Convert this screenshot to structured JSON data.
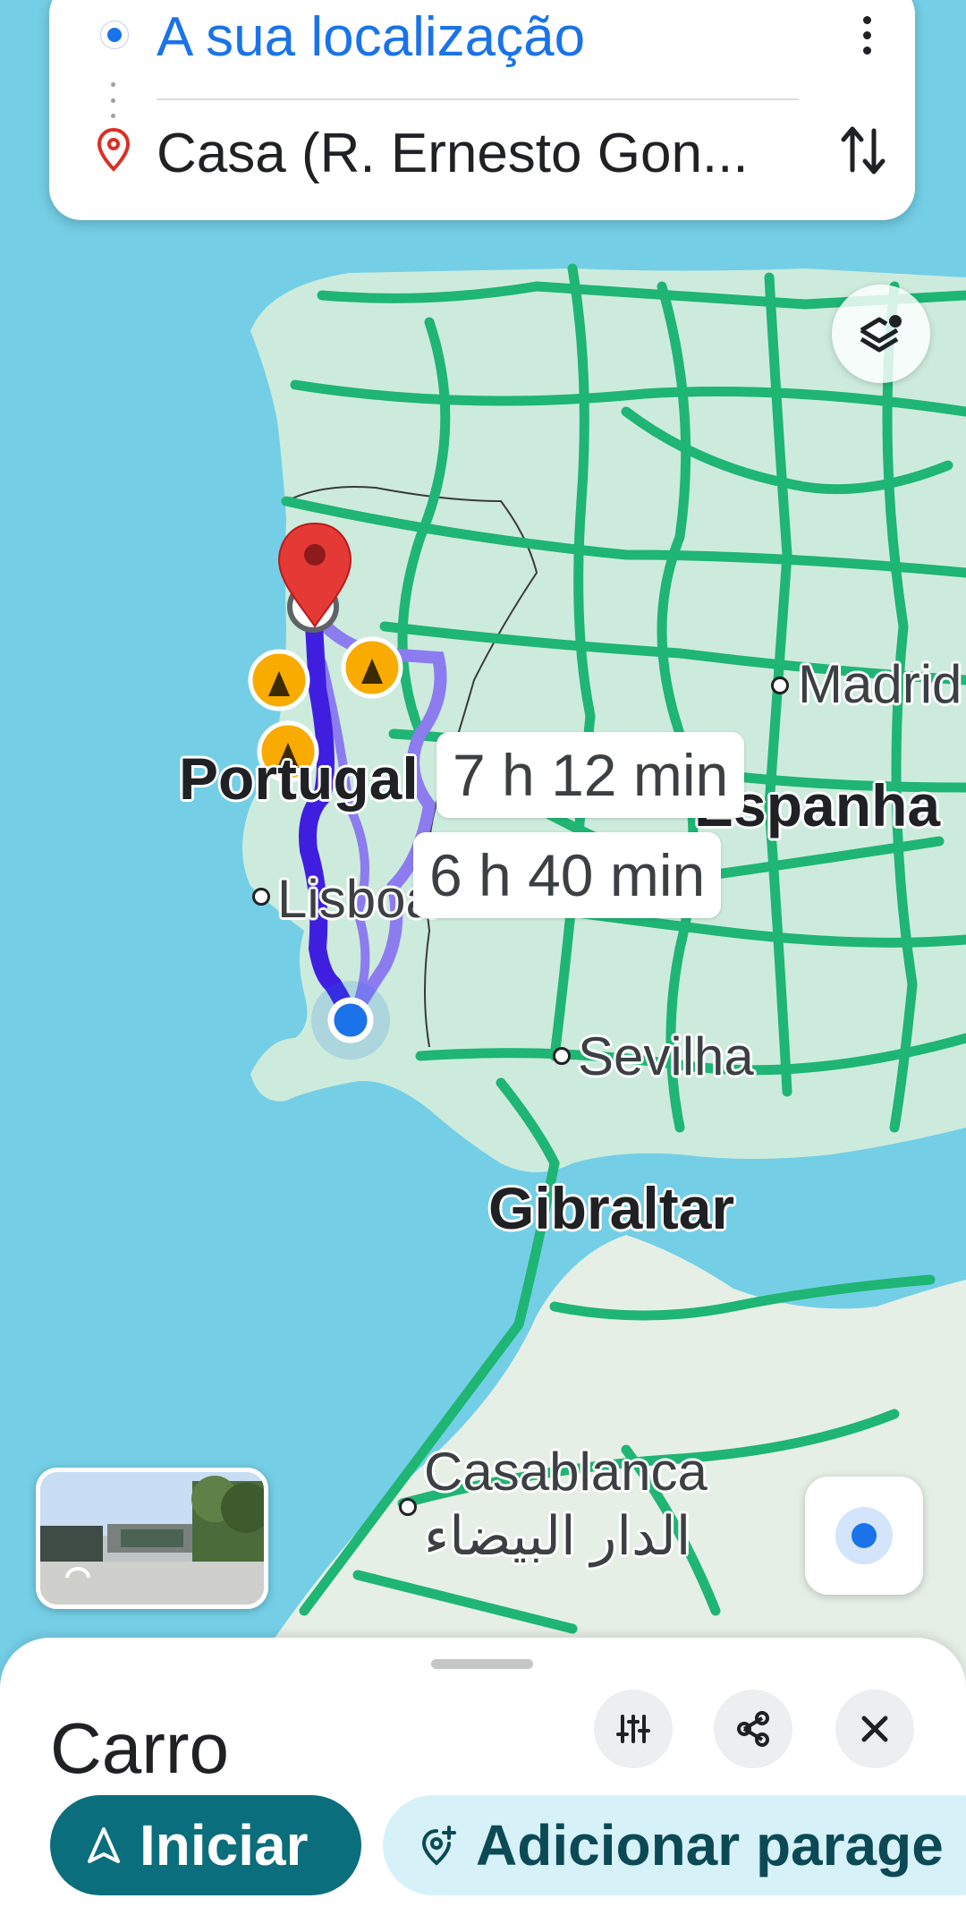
{
  "search": {
    "origin": "A sua localização",
    "destination": "Casa (R. Ernesto Gon..."
  },
  "map": {
    "route_times": [
      "7 h 12 min",
      "6 h 40 min"
    ],
    "labels": {
      "portugal": "Portugal",
      "espanha": "Espanha",
      "madrid": "Madrid",
      "lisboa": "Lisboa",
      "sevilha": "Sevilha",
      "gibraltar": "Gibraltar",
      "casablanca": "Casablanca",
      "casablanca_ar": "الدار البيضاء"
    },
    "colors": {
      "water": "#74cfe6",
      "land": "#cdebdc",
      "roads": "#1fb574",
      "route_primary": "#3f1ee0",
      "route_alt": "#8c7cf0",
      "destination_pin": "#e53935",
      "location_dot": "#1a73e8"
    }
  },
  "sheet": {
    "mode": "Carro",
    "start_label": "Iniciar",
    "add_stop_label": "Adicionar parage"
  },
  "icons": {
    "origin": "location-dot-icon",
    "destination": "map-pin-icon",
    "more": "more-vert-icon",
    "swap": "swap-vert-icon",
    "layers": "layers-icon",
    "roadworks": "road-works-icon",
    "tune": "tune-icon",
    "share": "share-icon",
    "close": "close-icon",
    "navigate": "navigation-arrow-icon",
    "add_stop": "add-location-icon"
  }
}
